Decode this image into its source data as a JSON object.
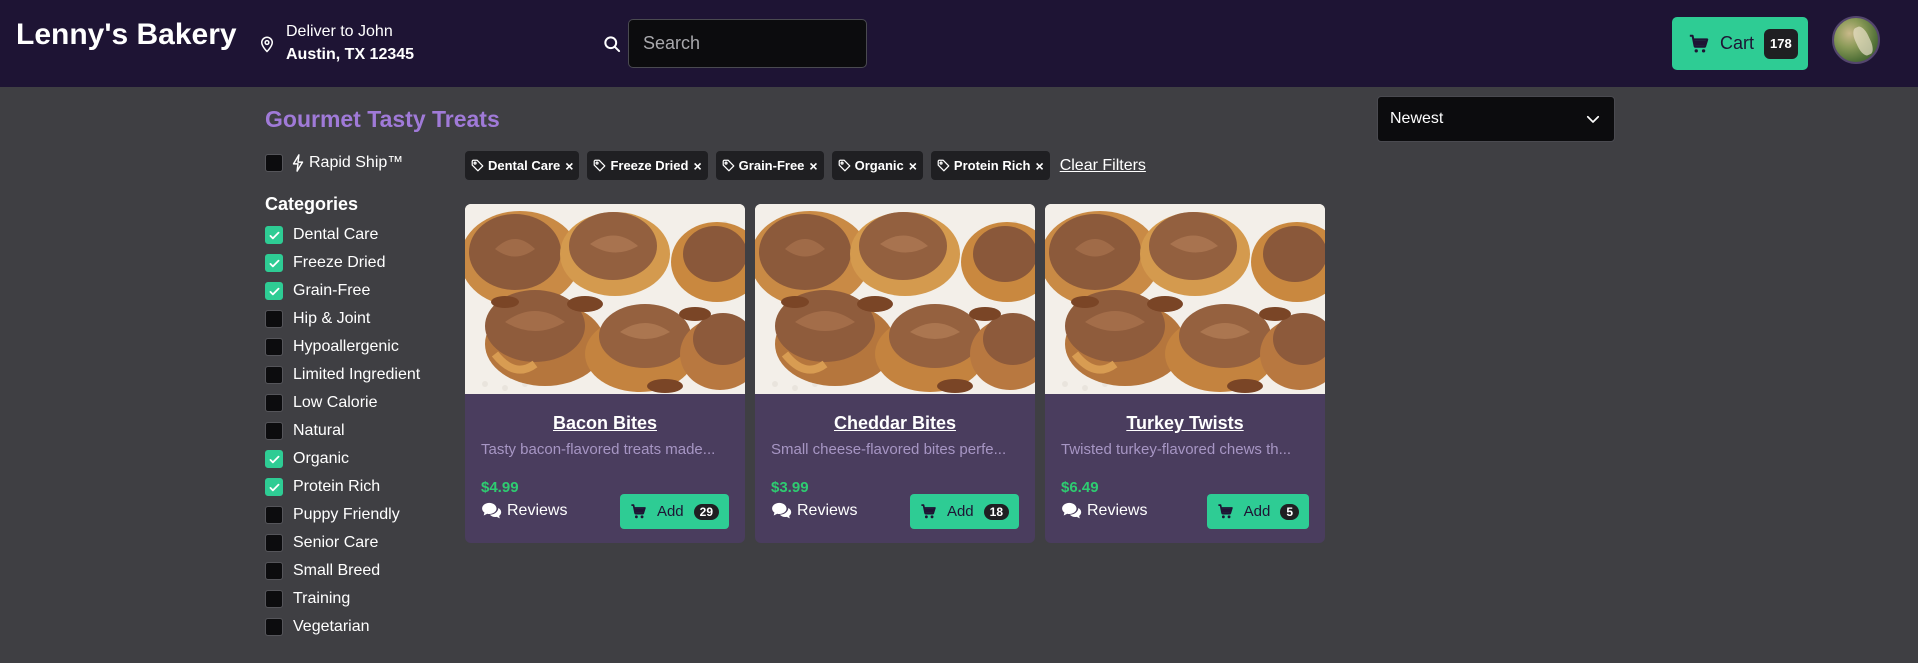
{
  "header": {
    "brand": "Lenny's Bakery",
    "deliver_line1": "Deliver to John",
    "deliver_line2": "Austin, TX 12345",
    "search_placeholder": "Search",
    "cart_label": "Cart",
    "cart_count": "178"
  },
  "sort": {
    "selected": "Newest"
  },
  "sidebar": {
    "title": "Gourmet Tasty Treats",
    "rapid_ship": {
      "label": "Rapid Ship™",
      "checked": false
    },
    "categories_heading": "Categories",
    "categories": [
      {
        "label": "Dental Care",
        "checked": true
      },
      {
        "label": "Freeze Dried",
        "checked": true
      },
      {
        "label": "Grain-Free",
        "checked": true
      },
      {
        "label": "Hip & Joint",
        "checked": false
      },
      {
        "label": "Hypoallergenic",
        "checked": false
      },
      {
        "label": "Limited Ingredient",
        "checked": false
      },
      {
        "label": "Low Calorie",
        "checked": false
      },
      {
        "label": "Natural",
        "checked": false
      },
      {
        "label": "Organic",
        "checked": true
      },
      {
        "label": "Protein Rich",
        "checked": true
      },
      {
        "label": "Puppy Friendly",
        "checked": false
      },
      {
        "label": "Senior Care",
        "checked": false
      },
      {
        "label": "Small Breed",
        "checked": false
      },
      {
        "label": "Training",
        "checked": false
      },
      {
        "label": "Vegetarian",
        "checked": false
      }
    ]
  },
  "filters": {
    "chips": [
      "Dental Care",
      "Freeze Dried",
      "Grain-Free",
      "Organic",
      "Protein Rich"
    ],
    "remove_glyph": "×",
    "clear_label": "Clear Filters"
  },
  "products": [
    {
      "name": "Bacon Bites",
      "description": "Tasty bacon-flavored treats made...",
      "price": "$4.99",
      "reviews_label": "Reviews",
      "add_label": "Add",
      "add_count": "29"
    },
    {
      "name": "Cheddar Bites",
      "description": "Small cheese-flavored bites perfe...",
      "price": "$3.99",
      "reviews_label": "Reviews",
      "add_label": "Add",
      "add_count": "18"
    },
    {
      "name": "Turkey Twists",
      "description": "Twisted turkey-flavored chews th...",
      "price": "$6.49",
      "reviews_label": "Reviews",
      "add_label": "Add",
      "add_count": "5"
    }
  ],
  "colors": {
    "header_bg": "#1e1434",
    "page_bg": "#3f3f43",
    "accent": "#2ecc94",
    "title": "#a07ad8",
    "card_bg": "#4a3d5e",
    "price": "#2ecc71"
  },
  "icons": {
    "location": "map-pin-icon",
    "search": "search-icon",
    "cart": "cart-icon",
    "bolt": "bolt-icon",
    "tag": "tag-icon",
    "reviews": "chat-bubbles-icon",
    "dropdown": "chevron-down-icon"
  }
}
